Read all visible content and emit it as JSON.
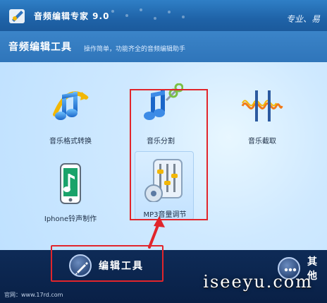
{
  "window": {
    "title": "音频编辑专家 9.0",
    "slogan": "专业、易"
  },
  "header": {
    "title": "音频编辑工具",
    "subtitle": "操作简单，功能齐全的音频编辑助手"
  },
  "tools": [
    {
      "label": "音乐格式转换",
      "icon": "music-format-convert-icon"
    },
    {
      "label": "音乐分割",
      "icon": "music-split-icon"
    },
    {
      "label": "音乐截取",
      "icon": "music-trim-icon"
    },
    {
      "label": "Iphone铃声制作",
      "icon": "iphone-ringtone-icon"
    },
    {
      "label": "MP3音量调节",
      "icon": "mp3-volume-adjust-icon"
    }
  ],
  "bottom": {
    "primary_button": {
      "label": "编辑工具",
      "icon": "pen-icon"
    },
    "secondary_button": {
      "label": "其他",
      "icon": "more-dots-icon"
    },
    "website": "官网：www.17rd.com",
    "watermark": "iseeyu.com"
  },
  "colors": {
    "title_bar": "#1f63a8",
    "header_bar": "#2f75ba",
    "panel": "#cfe9ff",
    "bottom_bar": "#0e2b57",
    "highlight": "#e1252b"
  }
}
